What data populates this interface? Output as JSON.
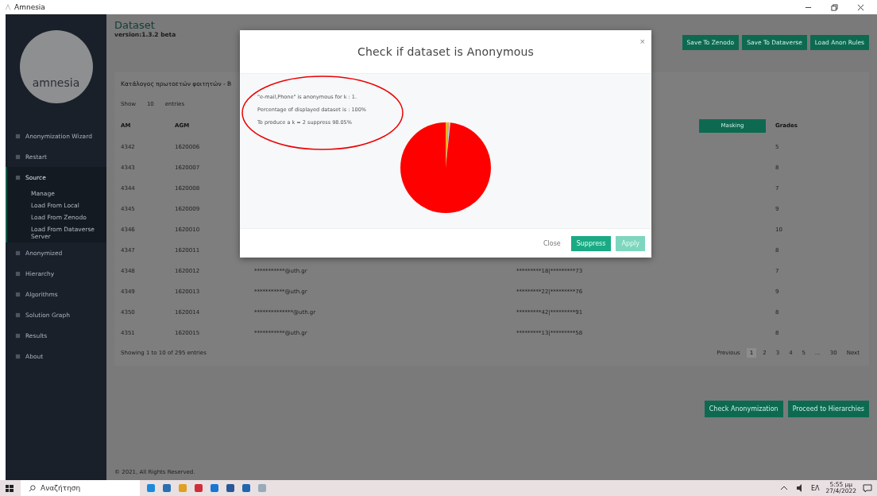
{
  "window": {
    "title": "Amnesia"
  },
  "sidebar": {
    "logo_text": "amnesia",
    "items": [
      {
        "label": "Anonymization Wizard",
        "expanded": false
      },
      {
        "label": "Restart",
        "expanded": false
      },
      {
        "label": "Source",
        "expanded": true,
        "children": [
          {
            "label": "Manage"
          },
          {
            "label": "Load From Local"
          },
          {
            "label": "Load From Zenodo"
          },
          {
            "label": "Load From Dataverse Server"
          }
        ]
      },
      {
        "label": "Anonymized",
        "expanded": false
      },
      {
        "label": "Hierarchy",
        "expanded": false
      },
      {
        "label": "Algorithms",
        "expanded": false
      },
      {
        "label": "Solution Graph",
        "expanded": false
      },
      {
        "label": "Results",
        "expanded": false
      },
      {
        "label": "About",
        "expanded": false
      }
    ]
  },
  "header": {
    "title": "Dataset",
    "version": "version:1.3.2 beta"
  },
  "toolbar": [
    "Save To Zenodo",
    "Save To Dataverse",
    "Load Anon Rules"
  ],
  "card": {
    "title": "Κατάλογος πρωτοετών φοιτητών - B",
    "show": "Show",
    "page_size": "10",
    "entries": "entries"
  },
  "table": {
    "columns": [
      "AM",
      "AGM"
    ],
    "masking_button": "Masking",
    "grades_column": "Grades",
    "rows": [
      {
        "am": "4342",
        "agm": "1620006",
        "grade": "5"
      },
      {
        "am": "4343",
        "agm": "1620007",
        "grade": "8"
      },
      {
        "am": "4344",
        "agm": "1620008",
        "grade": "7"
      },
      {
        "am": "4345",
        "agm": "1620009",
        "grade": "9"
      },
      {
        "am": "4346",
        "agm": "1620010",
        "grade": "10"
      },
      {
        "am": "4347",
        "agm": "1620011",
        "grade": "8"
      },
      {
        "am": "4348",
        "agm": "1620012",
        "email": "***********@uth.gr",
        "phone": "*********18|*********73",
        "grade": "7"
      },
      {
        "am": "4349",
        "agm": "1620013",
        "email": "***********@uth.gr",
        "phone": "*********22|*********76",
        "grade": "9"
      },
      {
        "am": "4350",
        "agm": "1620014",
        "email": "**************@uth.gr",
        "phone": "*********42|*********91",
        "grade": "8"
      },
      {
        "am": "4351",
        "agm": "1620015",
        "email": "***********@uth.gr",
        "phone": "*********13|*********58",
        "grade": "8"
      }
    ]
  },
  "table_info": "Showing 1 to 10 of 295 entries",
  "pagination": [
    {
      "label": "Previous",
      "selected": false
    },
    {
      "label": "1",
      "selected": true
    },
    {
      "label": "2",
      "selected": false
    },
    {
      "label": "3",
      "selected": false
    },
    {
      "label": "4",
      "selected": false
    },
    {
      "label": "5",
      "selected": false
    },
    {
      "label": "...",
      "selected": false
    },
    {
      "label": "30",
      "selected": false
    },
    {
      "label": "Next",
      "selected": false
    }
  ],
  "actions": [
    "Check Anonymization",
    "Proceed to Hierarchies"
  ],
  "footer": "© 2021, All Rights Reserved.",
  "modal": {
    "title": "Check if dataset is Anonymous",
    "close_glyph": "×",
    "lines": [
      "\"e-mail,Phone\" is anonymous for k : 1.",
      "Percentage of displayed dataset is : 100%",
      "To produce a k = 2 suppress 98.05%"
    ],
    "buttons": [
      {
        "label": "Close",
        "kind": "link"
      },
      {
        "label": "Suppress",
        "kind": "primary"
      },
      {
        "label": "Apply",
        "kind": "disabled"
      }
    ]
  },
  "taskbar": {
    "search_placeholder": "Αναζήτηση",
    "language": "ΕΛ",
    "time": "5:55 μμ",
    "date": "27/4/2022"
  }
}
